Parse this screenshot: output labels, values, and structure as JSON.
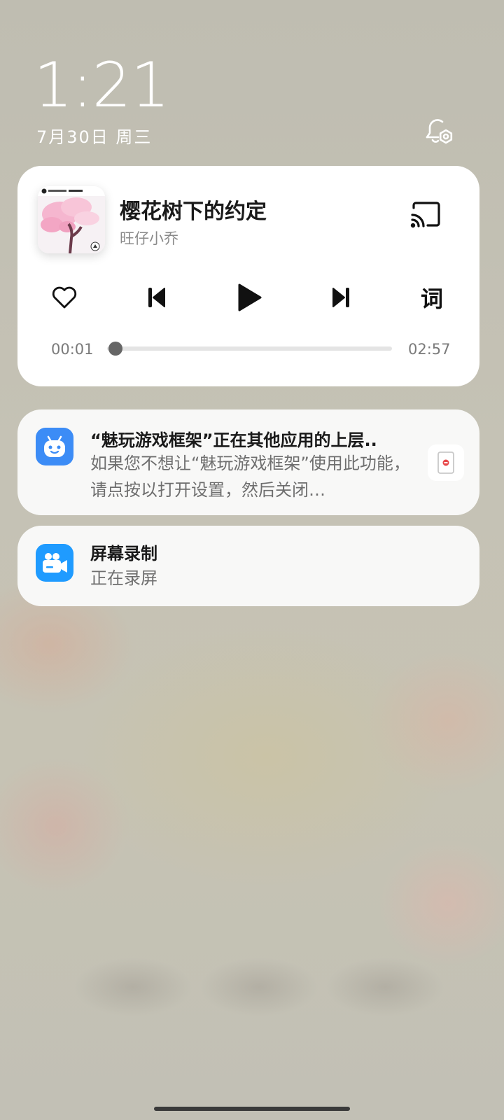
{
  "status": {
    "time": "1:21",
    "date": "7月30日 周三"
  },
  "media": {
    "title": "樱花树下的约定",
    "artist": "旺仔小乔",
    "lyrics_label": "词",
    "elapsed": "00:01",
    "duration": "02:57",
    "progress_fraction": 0.006,
    "liked": false,
    "playing": false
  },
  "notifications": [
    {
      "title": "“魅玩游戏框架”正在其他应用的上层..",
      "body": "如果您不想让“魅玩游戏框架”使用此功能，请点按以打开设置，然后关闭…",
      "icon": "android-robot-icon"
    },
    {
      "title": "屏幕录制",
      "body": "正在录屏",
      "icon": "video-camera-icon"
    }
  ],
  "colors": {
    "overlay_app_icon": "#3c8cf6",
    "record_app_icon": "#1f9bff",
    "progress_thumb": "#666666"
  }
}
